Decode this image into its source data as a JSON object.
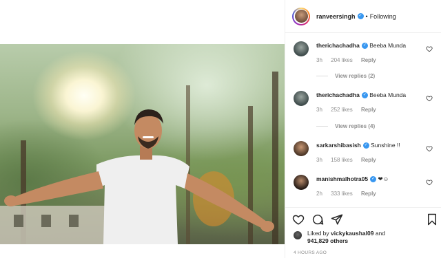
{
  "post": {
    "image_alt": "Man in white t-shirt with arms spread in sunlit forest"
  },
  "header": {
    "username": "ranveersingh",
    "separator": "•",
    "follow_status": "Following"
  },
  "comments": [
    {
      "user": "therichachadha",
      "text": "Beeba Munda",
      "time": "3h",
      "likes": "204 likes",
      "reply": "Reply",
      "view_replies": "View replies (2)"
    },
    {
      "user": "therichachadha",
      "text": "Beeba Munda",
      "time": "3h",
      "likes": "252 likes",
      "reply": "Reply",
      "view_replies": "View replies (4)"
    },
    {
      "user": "sarkarshibasish",
      "text": "Sunshine !!",
      "time": "3h",
      "likes": "158 likes",
      "reply": "Reply"
    },
    {
      "user": "manishmalhotra05",
      "text": "❤☺",
      "time": "2h",
      "likes": "333 likes",
      "reply": "Reply"
    }
  ],
  "actions": {
    "liked_prefix": "Liked by",
    "liked_user": "vickykaushal09",
    "liked_and": "and",
    "liked_others": "941,829 others",
    "timestamp": "4 HOURS AGO"
  },
  "colors": {
    "verified": "#3897f0",
    "muted": "#8e8e8e",
    "text": "#262626"
  },
  "icons": [
    "heart-icon",
    "comment-icon",
    "share-icon",
    "bookmark-icon",
    "verified-badge-icon"
  ]
}
